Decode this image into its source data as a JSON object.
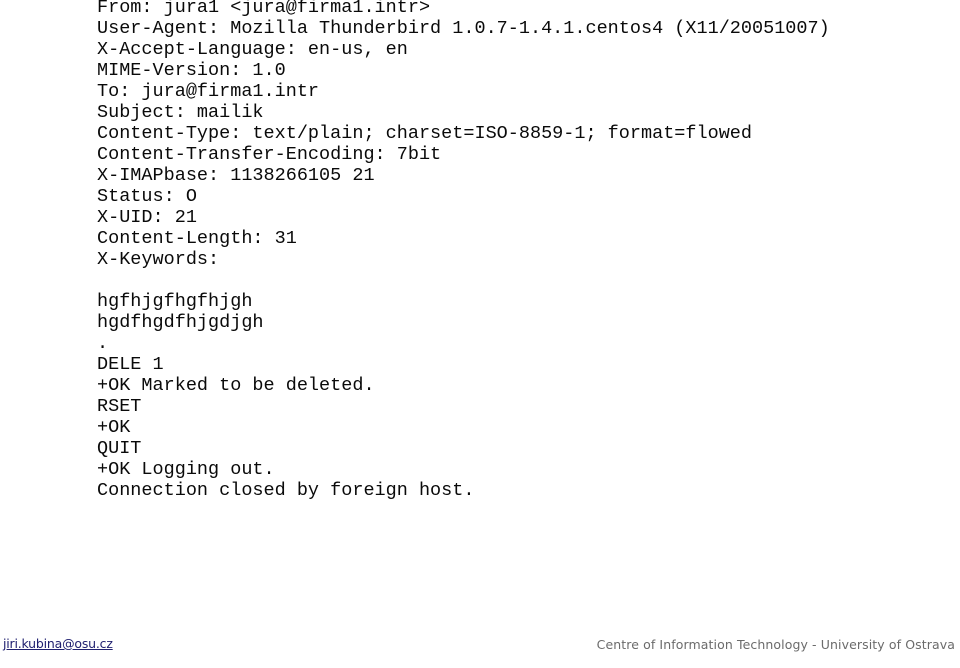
{
  "document": {
    "background_color": "#ffffff",
    "text_color": "#0a0a0a",
    "transcript_lines": [
      "From: jura1 <jura@firma1.intr>",
      "User-Agent: Mozilla Thunderbird 1.0.7-1.4.1.centos4 (X11/20051007)",
      "X-Accept-Language: en-us, en",
      "MIME-Version: 1.0",
      "To: jura@firma1.intr",
      "Subject: mailik",
      "Content-Type: text/plain; charset=ISO-8859-1; format=flowed",
      "Content-Transfer-Encoding: 7bit",
      "X-IMAPbase: 1138266105 21",
      "Status: O",
      "X-UID: 21",
      "Content-Length: 31",
      "X-Keywords:",
      "",
      "hgfhjgfhgfhjgh",
      "hgdfhgdfhjgdjgh",
      ".",
      "DELE 1",
      "+OK Marked to be deleted.",
      "RSET",
      "+OK",
      "QUIT",
      "+OK Logging out.",
      "Connection closed by foreign host."
    ]
  },
  "footer": {
    "email": "jiri.kubina@osu.cz",
    "email_color": "#202070",
    "organization": "Centre of Information Technology - University of Ostrava",
    "organization_color": "#6b6b6b"
  }
}
